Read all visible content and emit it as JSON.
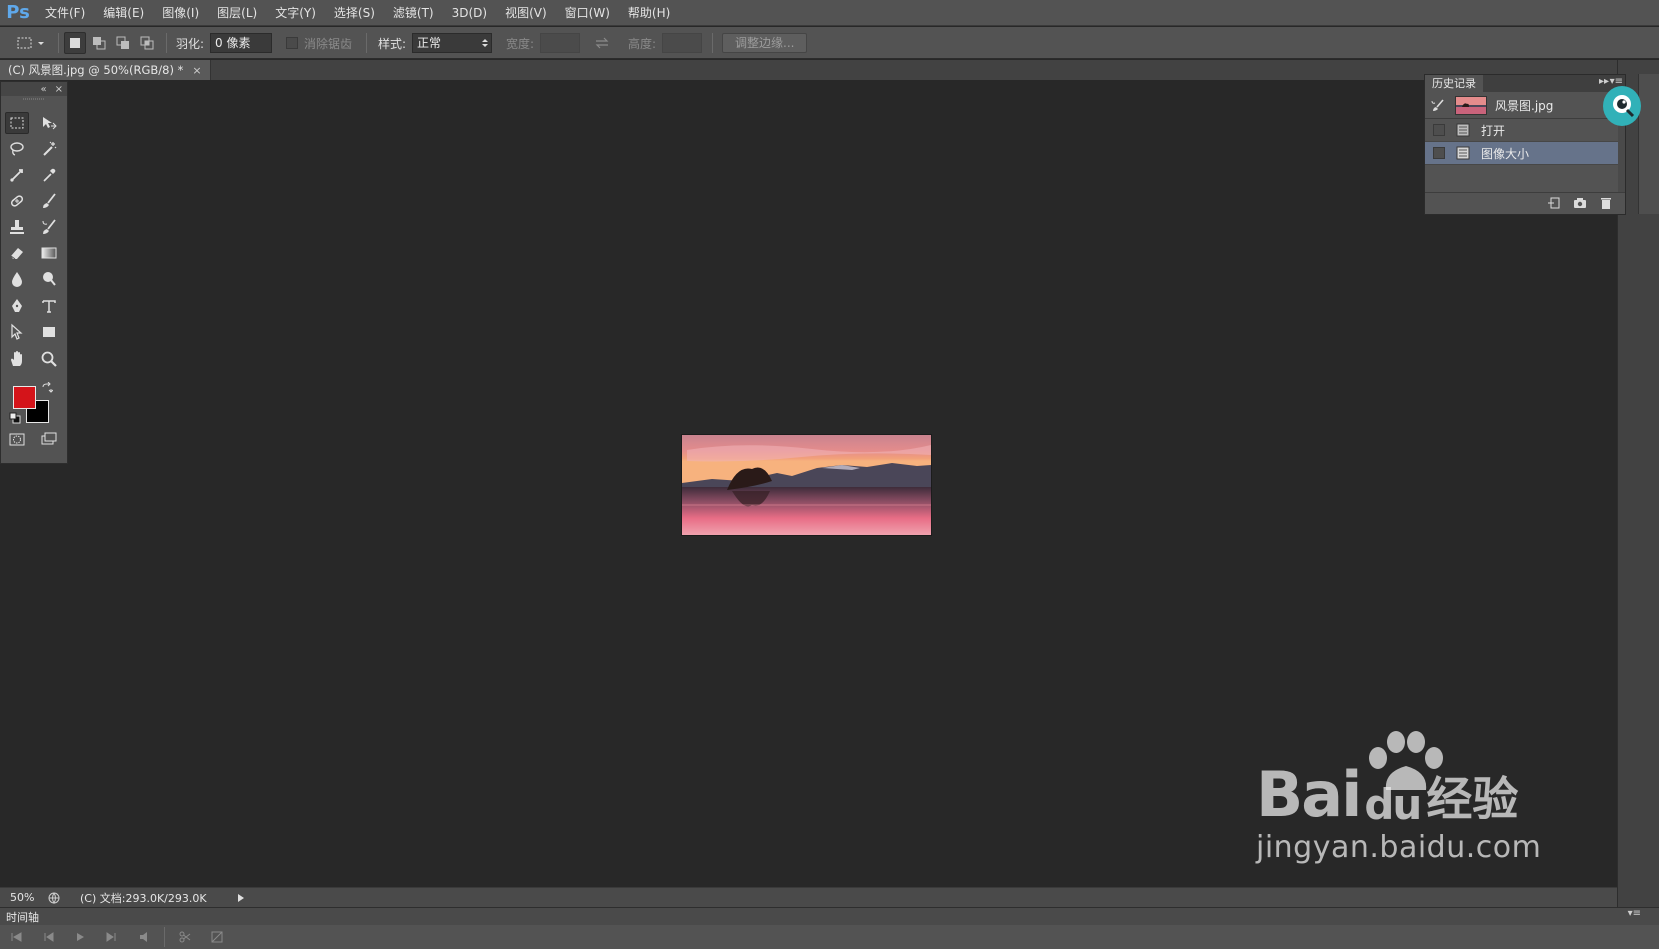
{
  "app": {
    "logo": "Ps"
  },
  "menu": [
    "文件(F)",
    "编辑(E)",
    "图像(I)",
    "图层(L)",
    "文字(Y)",
    "选择(S)",
    "滤镜(T)",
    "3D(D)",
    "视图(V)",
    "窗口(W)",
    "帮助(H)"
  ],
  "options": {
    "feather_label": "羽化:",
    "feather_value": "0 像素",
    "antialias_label": "消除锯齿",
    "style_label": "样式:",
    "style_value": "正常",
    "width_label": "宽度:",
    "height_label": "高度:",
    "refine_edge": "调整边缘..."
  },
  "document": {
    "tab_title": "(C) 风景图.jpg @ 50%(RGB/8) *",
    "close": "×"
  },
  "colors": {
    "foreground": "#d4141a",
    "background": "#000000",
    "accent": "#66738a"
  },
  "history": {
    "tab": "历史记录",
    "snapshot_label": "风景图.jpg",
    "states": [
      {
        "label": "打开",
        "active": false
      },
      {
        "label": "图像大小",
        "active": true
      }
    ]
  },
  "status": {
    "zoom": "50%",
    "doc_info": "(C) 文档:293.0K/293.0K"
  },
  "timeline": {
    "tab": "时间轴"
  },
  "watermark": {
    "brand_latin": "Bai",
    "brand_du": "du",
    "brand_cn": "经验",
    "url": "jingyan.baidu.com"
  },
  "icons": {
    "tools": [
      "rect-marquee-icon",
      "move-icon",
      "lasso-icon",
      "magic-wand-icon",
      "crop-icon",
      "eyedropper-icon",
      "healing-brush-icon",
      "brush-icon",
      "clone-stamp-icon",
      "history-brush-icon",
      "eraser-icon",
      "gradient-icon",
      "blur-icon",
      "dodge-icon",
      "pen-icon",
      "type-icon",
      "path-select-icon",
      "rectangle-shape-icon",
      "hand-icon",
      "zoom-icon"
    ]
  }
}
